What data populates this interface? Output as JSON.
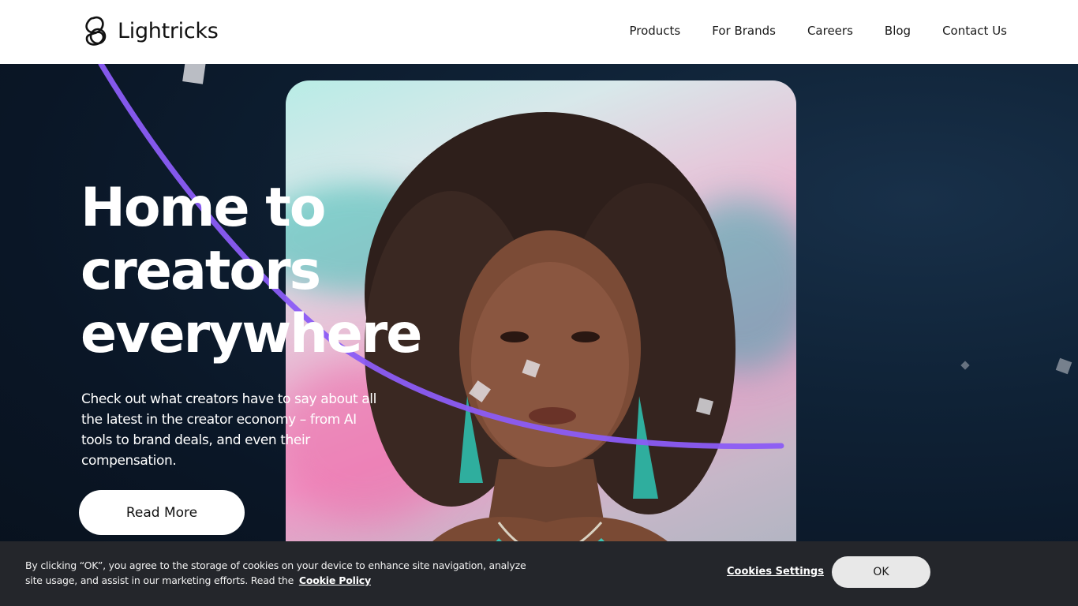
{
  "brand": {
    "name": "Lightricks",
    "logo_icon": "lightricks-swirl-logo"
  },
  "nav": {
    "items": [
      {
        "label": "Products"
      },
      {
        "label": "For Brands"
      },
      {
        "label": "Careers"
      },
      {
        "label": "Blog"
      },
      {
        "label": "Contact Us"
      }
    ]
  },
  "hero": {
    "headline_lines": [
      "Home to",
      "creators",
      "everywhere"
    ],
    "subtext": "Check out what creators have to say about all the latest in the creator economy – from AI tools to brand deals, and even their compensation.",
    "cta_label": "Read More",
    "accent_color": "#8b5cf6"
  },
  "cookie_banner": {
    "text": "By clicking “OK”, you agree to the storage of cookies on your device to enhance site navigation, analyze site usage, and assist in our marketing efforts. Read the",
    "policy_link": "Cookie Policy",
    "settings_label": "Cookies Settings",
    "ok_label": "OK"
  }
}
